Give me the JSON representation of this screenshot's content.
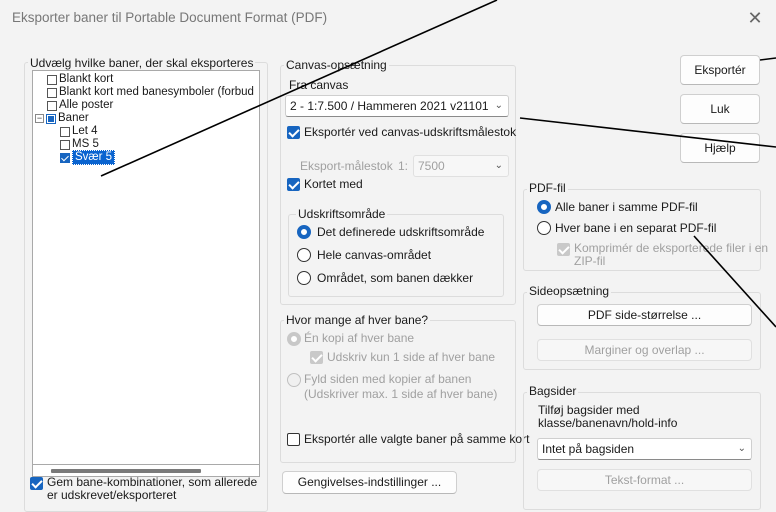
{
  "window": {
    "title": "Eksporter baner til Portable Document Format (PDF)",
    "close_symbol": "✕"
  },
  "courses": {
    "legend": "Udvælg hvilke baner, der skal eksporteres",
    "items": [
      {
        "label": "Blankt kort",
        "checked": false
      },
      {
        "label": "Blankt kort med banesymboler (forbud",
        "checked": false
      },
      {
        "label": "Alle poster",
        "checked": false
      },
      {
        "label": "Baner",
        "checked": "partial"
      },
      {
        "label": "Let 4",
        "checked": false
      },
      {
        "label": "MS 5",
        "checked": false
      },
      {
        "label": "Svær 5",
        "checked": true,
        "selected": true
      }
    ],
    "expander_symbol": "−",
    "remember_label": "Gem bane-kombinationer, som allerede er udskrevet/eksporteret"
  },
  "canvas": {
    "legend": "Canvas-opsætning",
    "from_label": "Fra canvas",
    "canvas_value": "2 - 1:7.500 / Hammeren 2021 v21101",
    "export_canvas_scale_label": "Eksportér ved canvas-udskriftsmålestok",
    "scale_label": "Eksport-målestok",
    "scale_prefix": "1:",
    "scale_value": "7500",
    "map_with_label": "Kortet med",
    "print_area_legend": "Udskriftsområde",
    "print_area_options": [
      "Det definerede udskriftsområde",
      "Hele canvas-området",
      "Området, som banen dækker"
    ]
  },
  "copies": {
    "legend": "Hvor mange af hver bane?",
    "one_copy_label": "Én kopi af hver bane",
    "one_page_label": "Udskriv kun 1 side af hver bane",
    "fill_label_1": "Fyld siden med kopier af banen",
    "fill_label_2": "(Udskriver max. 1 side af hver bane)",
    "same_map_label": "Eksportér alle valgte baner på samme kort"
  },
  "render_button": "Gengivelses-indstillinger ...",
  "buttons": {
    "export": "Eksportér",
    "close": "Luk",
    "help": "Hjælp"
  },
  "pdf_file": {
    "legend": "PDF-fil",
    "same_file_label": "Alle baner i samme PDF-fil",
    "separate_file_label": "Hver bane i en separat PDF-fil",
    "compress_label_1": "Komprimér de eksporterede filer i en",
    "compress_label_2": "ZIP-fil"
  },
  "page_setup": {
    "legend": "Sideopsætning",
    "page_size_button": "PDF side-størrelse ...",
    "margins_button": "Marginer og overlap ..."
  },
  "back_pages": {
    "legend": "Bagsider",
    "desc_1": "Tilføj bagsider med",
    "desc_2": "klasse/banenavn/hold-info",
    "select_value": "Intet på bagsiden",
    "text_format_button": "Tekst-format ..."
  },
  "icons": {
    "chevron": "chevron-down-icon",
    "close": "close-icon",
    "collapse": "collapse-icon"
  },
  "colors": {
    "accent": "#1765c0",
    "selection": "#0a64d0",
    "disabled_text": "#a0a0a0"
  }
}
